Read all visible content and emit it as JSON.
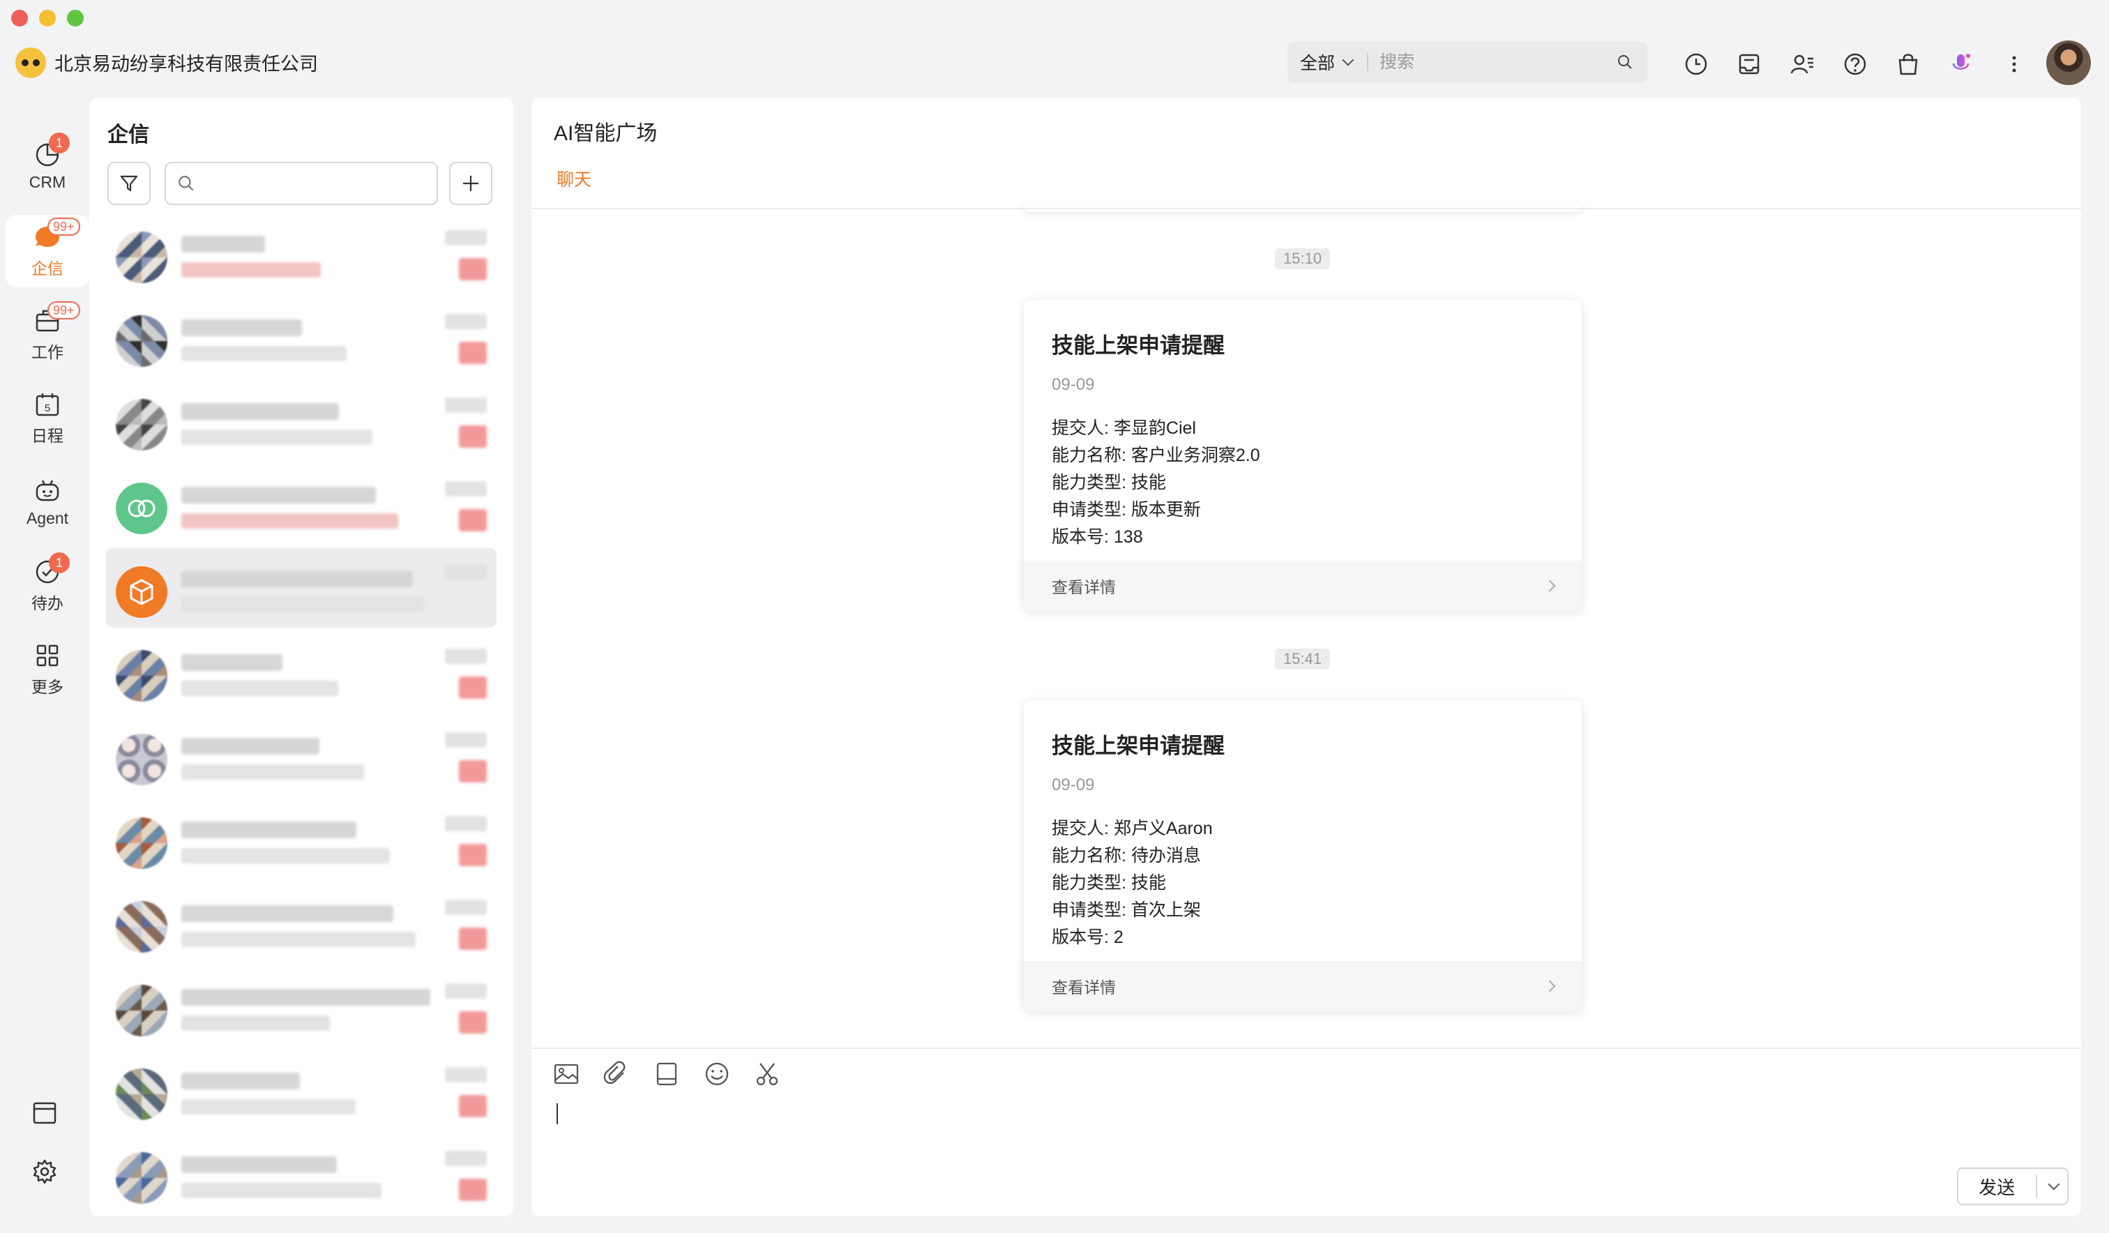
{
  "window": {
    "company_name": "北京易动纷享科技有限责任公司"
  },
  "header": {
    "search_scope": "全部",
    "search_placeholder": "搜索",
    "icons": [
      "history-icon",
      "inbox-icon",
      "contacts-icon",
      "help-icon",
      "shopping-bag-icon",
      "voice-assistant-icon",
      "more-icon"
    ]
  },
  "rail": {
    "items": [
      {
        "label": "CRM",
        "badge": "1"
      },
      {
        "label": "企信",
        "badge": "99+"
      },
      {
        "label": "工作",
        "badge": "99+"
      },
      {
        "label": "日程",
        "badge": ""
      },
      {
        "label": "Agent",
        "badge": ""
      },
      {
        "label": "待办",
        "badge": "1"
      },
      {
        "label": "更多",
        "badge": ""
      }
    ],
    "calendar_day": "5"
  },
  "list": {
    "title": "企信",
    "search_placeholder": ""
  },
  "chat": {
    "title": "AI智能广场",
    "tab": "聊天",
    "messages": [
      {
        "time": "15:10",
        "card_title": "技能上架申请提醒",
        "date": "09-09",
        "fields": [
          "提交人: 李显韵Ciel",
          "能力名称: 客户业务洞察2.0",
          "能力类型: 技能",
          "申请类型: 版本更新",
          "版本号: 138"
        ],
        "footer": "查看详情"
      },
      {
        "time": "15:41",
        "card_title": "技能上架申请提醒",
        "date": "09-09",
        "fields": [
          "提交人: 郑卢义Aaron",
          "能力名称: 待办消息",
          "能力类型: 技能",
          "申请类型: 首次上架",
          "版本号: 2"
        ],
        "footer": "查看详情"
      }
    ],
    "send_label": "发送"
  },
  "colors": {
    "accent": "#f07a25",
    "badge": "#f06a4e"
  }
}
